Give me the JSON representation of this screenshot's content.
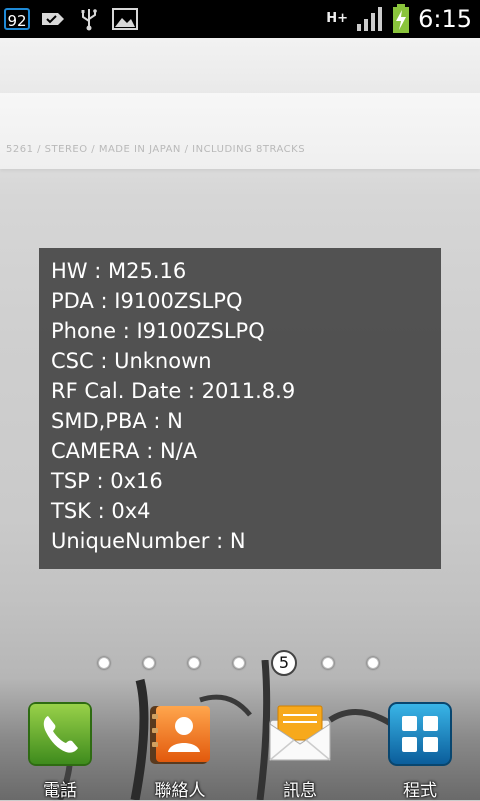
{
  "status_bar": {
    "notification_count": "92",
    "network_type": "H+",
    "time": "6:15",
    "icons": [
      "notification-badge",
      "message-tag-icon",
      "usb-icon",
      "image-icon",
      "hplus-network-icon",
      "signal-icon",
      "battery-charging-icon"
    ]
  },
  "wallpaper": {
    "text": "5261 / STEREO / MADE IN JAPAN / INCLUDING 8TRACKS"
  },
  "info_panel": {
    "lines": [
      "HW : M25.16",
      "PDA : I9100ZSLPQ",
      "Phone : I9100ZSLPQ",
      "CSC : Unknown",
      "RF Cal. Date : 2011.8.9",
      "SMD,PBA : N",
      "CAMERA : N/A",
      "TSP : 0x16",
      "TSK : 0x4",
      "UniqueNumber : N"
    ]
  },
  "pager": {
    "current_page": "5",
    "total_pages": 7
  },
  "dock": {
    "items": [
      {
        "label": "電話",
        "icon": "phone-icon"
      },
      {
        "label": "聯絡人",
        "icon": "contacts-icon"
      },
      {
        "label": "訊息",
        "icon": "messages-icon"
      },
      {
        "label": "程式",
        "icon": "apps-icon"
      }
    ]
  },
  "colors": {
    "status_bar_bg": "#000000",
    "panel_bg": "#464646",
    "accent_blue": "#1f8ad6",
    "battery_green": "#8ac43c"
  }
}
